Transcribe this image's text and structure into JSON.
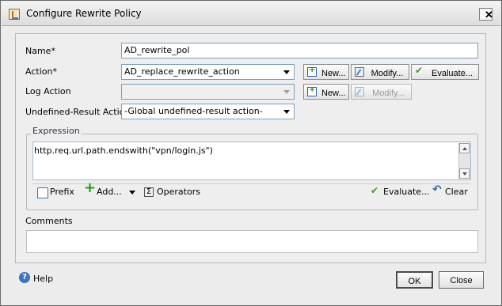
{
  "window": {
    "title": "Configure Rewrite Policy",
    "close_symbol": "✕"
  },
  "form": {
    "name_label": "Name*",
    "name_value": "AD_rewrite_pol",
    "action_label": "Action*",
    "action_value": "AD_replace_rewrite_action",
    "log_action_label": "Log Action",
    "log_action_value": "",
    "undefined_label": "Undefined-Result Action",
    "undefined_value": "-Global undefined-result action-"
  },
  "buttons": {
    "new": "New...",
    "modify": "Modify...",
    "evaluate": "Evaluate..."
  },
  "expression": {
    "legend": "Expression",
    "text": "http.req.url.path.endswith(\"vpn/login.js\")",
    "toolbar": {
      "prefix": "Prefix",
      "add": "Add...",
      "operators": "Operators",
      "evaluate": "Evaluate...",
      "clear": "Clear"
    }
  },
  "comments": {
    "label": "Comments",
    "value": ""
  },
  "footer": {
    "help": "Help",
    "ok": "OK",
    "close": "Close"
  },
  "icons": {
    "app": "rewrite-policy-icon",
    "new": "new-icon",
    "modify": "modify-icon",
    "evaluate": "check-icon",
    "prefix": "home-icon",
    "add": "plus-icon",
    "operators": "sigma-icon",
    "clear": "undo-icon",
    "help": "help-icon"
  }
}
